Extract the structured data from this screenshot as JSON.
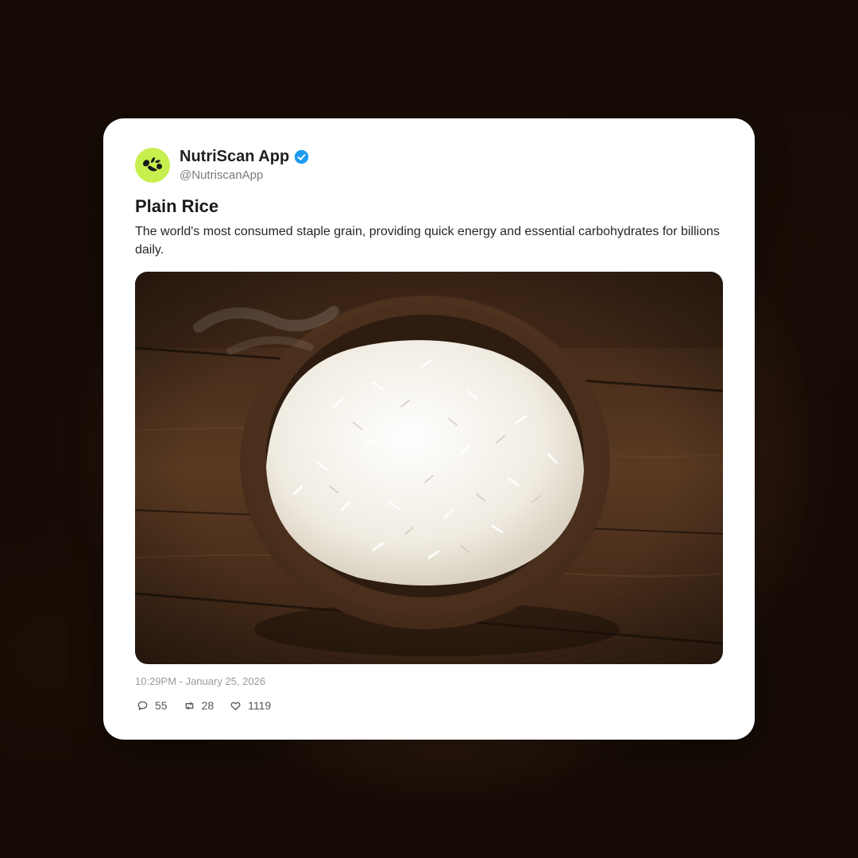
{
  "post": {
    "display_name": "NutriScan App",
    "handle": "@NutriscanApp",
    "verified": true,
    "title": "Plain Rice",
    "description": "The world's most consumed staple grain, providing quick energy and essential carbohydrates for billions daily.",
    "timestamp": "10:29PM - January 25, 2026",
    "stats": {
      "comments": "55",
      "retweets": "28",
      "likes": "1119"
    }
  },
  "icons": {
    "avatar": "nutriscan-logo-icon",
    "verified": "verified-badge-icon",
    "comments": "comment-icon",
    "retweets": "retweet-icon",
    "likes": "heart-icon"
  },
  "colors": {
    "avatar_bg": "#c7ef4e",
    "verified": "#1d9bf0",
    "card_bg": "#ffffff"
  }
}
